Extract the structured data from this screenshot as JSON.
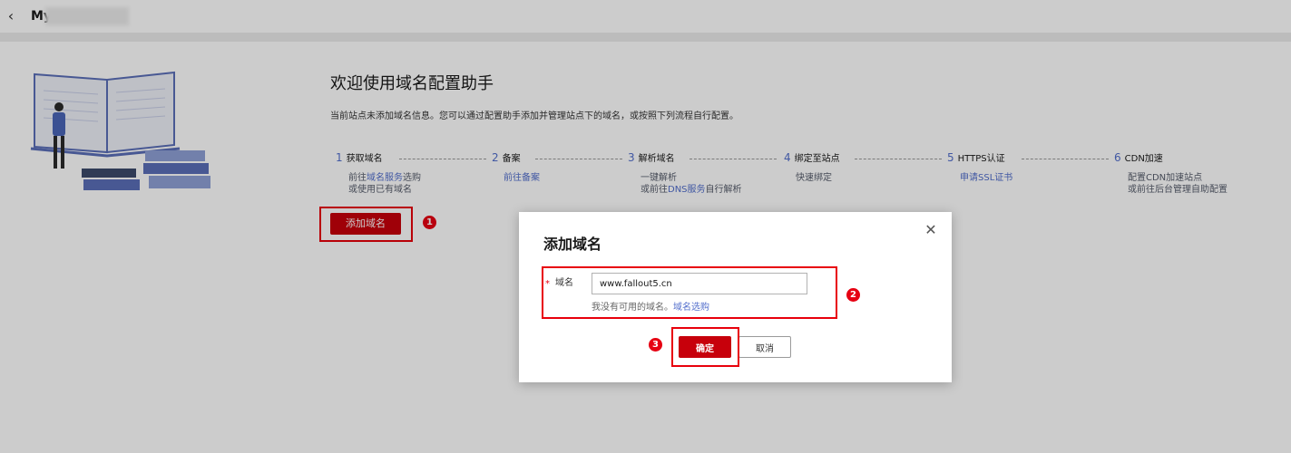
{
  "header": {
    "title": "My",
    "back_icon": "chevron-left-icon"
  },
  "main": {
    "heading": "欢迎使用域名配置助手",
    "description": "当前站点未添加域名信息。您可以通过配置助手添加并管理站点下的域名，或按照下列流程自行配置。",
    "steps": [
      {
        "num": "1",
        "label": "获取域名",
        "line1_pre": "前往",
        "line1_link": "域名服务",
        "line1_post": "选购",
        "line2": "或使用已有域名"
      },
      {
        "num": "2",
        "label": "备案",
        "line1_link": "前往备案"
      },
      {
        "num": "3",
        "label": "解析域名",
        "line1": "一键解析",
        "line2_pre": "或前往",
        "line2_link": "DNS服务",
        "line2_post": "自行解析"
      },
      {
        "num": "4",
        "label": "绑定至站点",
        "line1": "快速绑定"
      },
      {
        "num": "5",
        "label": "HTTPS认证",
        "line1_link": "申请SSL证书"
      },
      {
        "num": "6",
        "label": "CDN加速",
        "line1": "配置CDN加速站点",
        "line2": "或前往后台管理自助配置"
      }
    ],
    "add_button": "添加域名"
  },
  "annotations": {
    "badge1": "1",
    "badge2": "2",
    "badge3": "3",
    "highlight_color": "#e8000b"
  },
  "dialog": {
    "title": "添加域名",
    "field_required_mark": "*",
    "field_label": "域名",
    "field_value": "www.fallout5.cn",
    "hint_text": "我没有可用的域名。",
    "hint_link": "域名选购",
    "confirm": "确定",
    "cancel": "取消",
    "close_icon": "close-icon"
  },
  "colors": {
    "brand": "#c7000b",
    "link": "#526ecc"
  }
}
